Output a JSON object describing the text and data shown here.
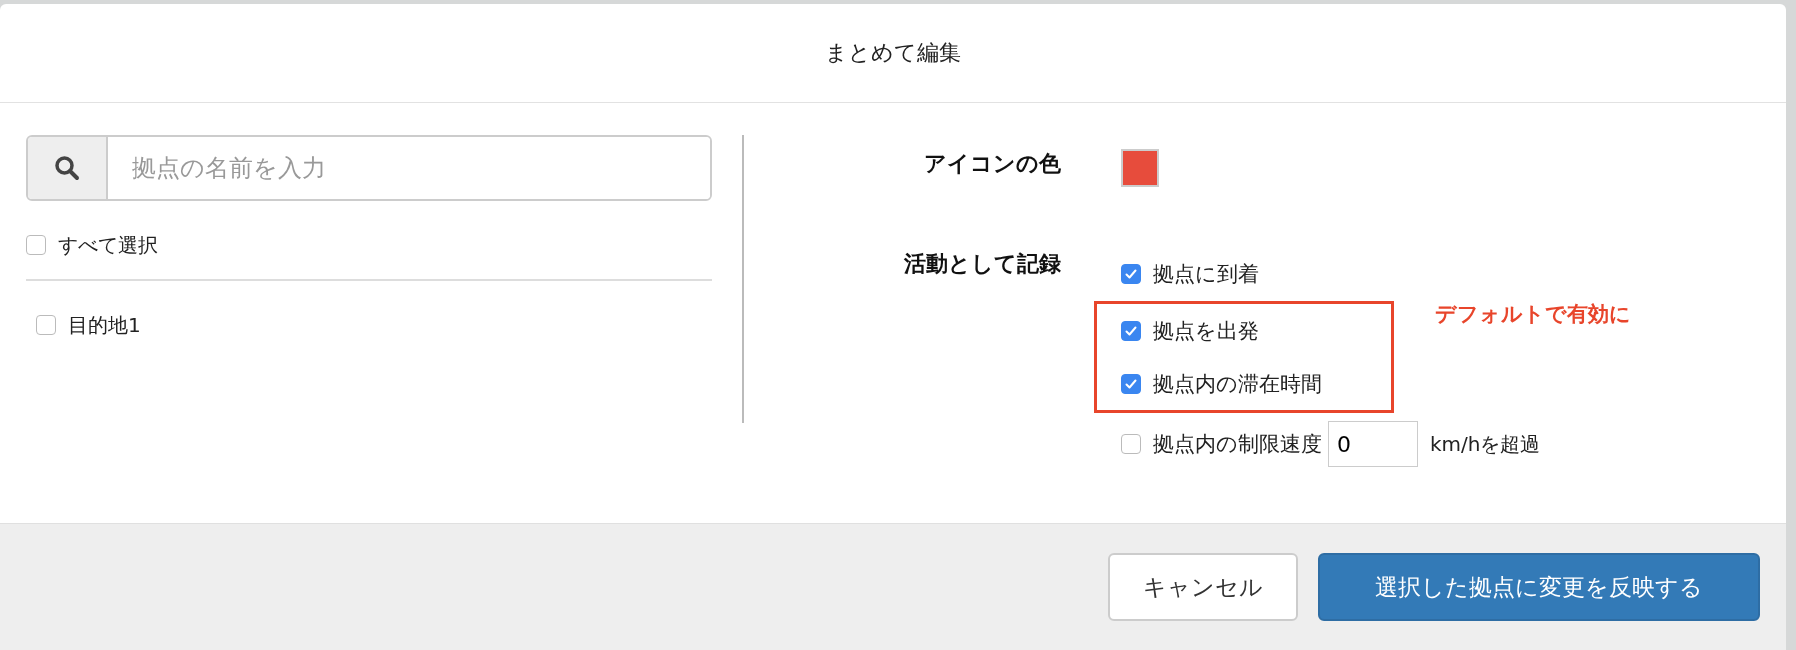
{
  "dialog": {
    "title": "まとめて編集"
  },
  "search": {
    "placeholder": "拠点の名前を入力"
  },
  "select_all": {
    "label": "すべて選択",
    "checked": false
  },
  "places": [
    {
      "label": "目的地1",
      "checked": false
    }
  ],
  "icon_color": {
    "label": "アイコンの色",
    "color": "#e74c3c"
  },
  "record": {
    "label": "活動として記録",
    "options": [
      {
        "kind": "check",
        "label": "拠点に到着",
        "checked": true,
        "highlighted": false
      },
      {
        "kind": "check",
        "label": "拠点を出発",
        "checked": true,
        "highlighted": true
      },
      {
        "kind": "check",
        "label": "拠点内の滞在時間",
        "checked": true,
        "highlighted": true
      },
      {
        "kind": "speed",
        "label": "拠点内の制限速度",
        "checked": false,
        "highlighted": false,
        "value": "0",
        "suffix": "km/hを超過"
      }
    ]
  },
  "annotation": {
    "text": "デフォルトで有効に"
  },
  "buttons": [
    {
      "label": "キャンセル",
      "kind": "secondary"
    },
    {
      "label": "選択した拠点に変更を反映する",
      "kind": "primary"
    }
  ]
}
